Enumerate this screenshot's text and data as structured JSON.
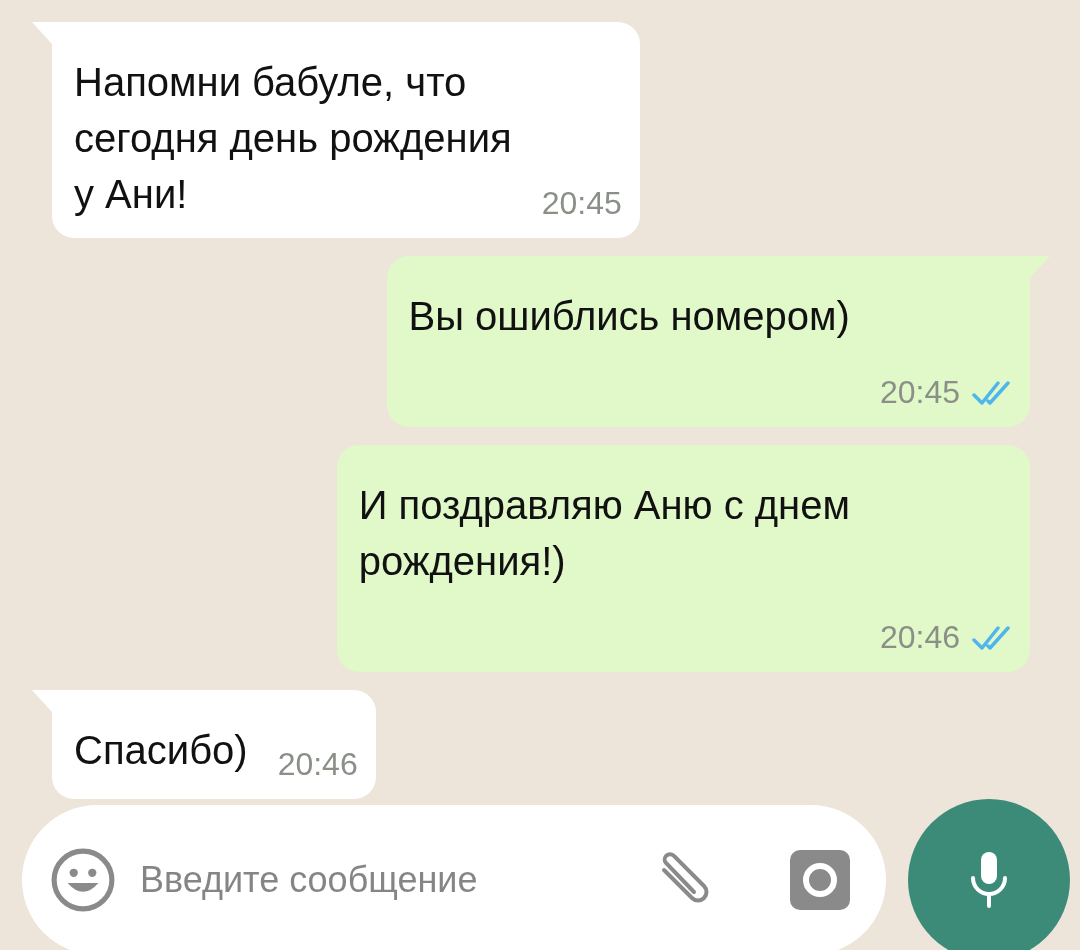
{
  "messages": [
    {
      "kind": "incoming",
      "text": "Напомни бабуле, что\nсегодня день рождения\nу Ани!",
      "time": "20:45",
      "tail": true
    },
    {
      "kind": "outgoing",
      "text": "Вы ошиблись номером)",
      "time": "20:45",
      "tail": true,
      "read": true
    },
    {
      "kind": "outgoing",
      "text": "И поздравляю Аню с днем\nрождения!)",
      "time": "20:46",
      "tail": false,
      "read": true
    },
    {
      "kind": "incoming",
      "text": "Спасибо)",
      "time": "20:46",
      "tail": true
    }
  ],
  "composer": {
    "placeholder": "Введите сообщение"
  }
}
